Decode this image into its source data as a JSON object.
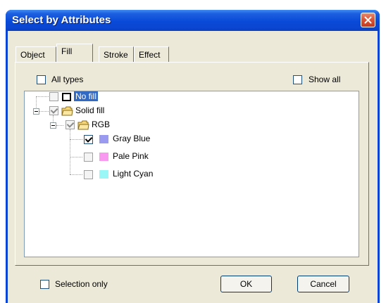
{
  "window": {
    "title": "Select by Attributes"
  },
  "tabs": [
    {
      "label": "Object",
      "active": false
    },
    {
      "label": "Fill",
      "active": true
    },
    {
      "label": "Stroke",
      "active": false
    },
    {
      "label": "Effect",
      "active": false
    }
  ],
  "options": {
    "all_types": {
      "label": "All types",
      "checked": false
    },
    "show_all": {
      "label": "Show all",
      "checked": false
    }
  },
  "tree": {
    "nodes": [
      {
        "label": "No fill",
        "checked": false,
        "selected": true
      },
      {
        "label": "Solid fill",
        "checked": true,
        "icon": "folder-icon"
      },
      {
        "label": "RGB",
        "checked": true,
        "icon": "folder-icon"
      },
      {
        "label": "Gray Blue",
        "checked": true,
        "color": "#9a9af0"
      },
      {
        "label": "Pale Pink",
        "checked": false,
        "color": "#f99af0"
      },
      {
        "label": "Light Cyan",
        "checked": false,
        "color": "#99f7f7"
      }
    ]
  },
  "footer": {
    "selection_only": {
      "label": "Selection only",
      "checked": false
    },
    "ok_label": "OK",
    "cancel_label": "Cancel"
  },
  "colors": {
    "title_bar": "#0a4ad8",
    "dialog_face": "#ece9d8",
    "selection": "#316ac5"
  }
}
